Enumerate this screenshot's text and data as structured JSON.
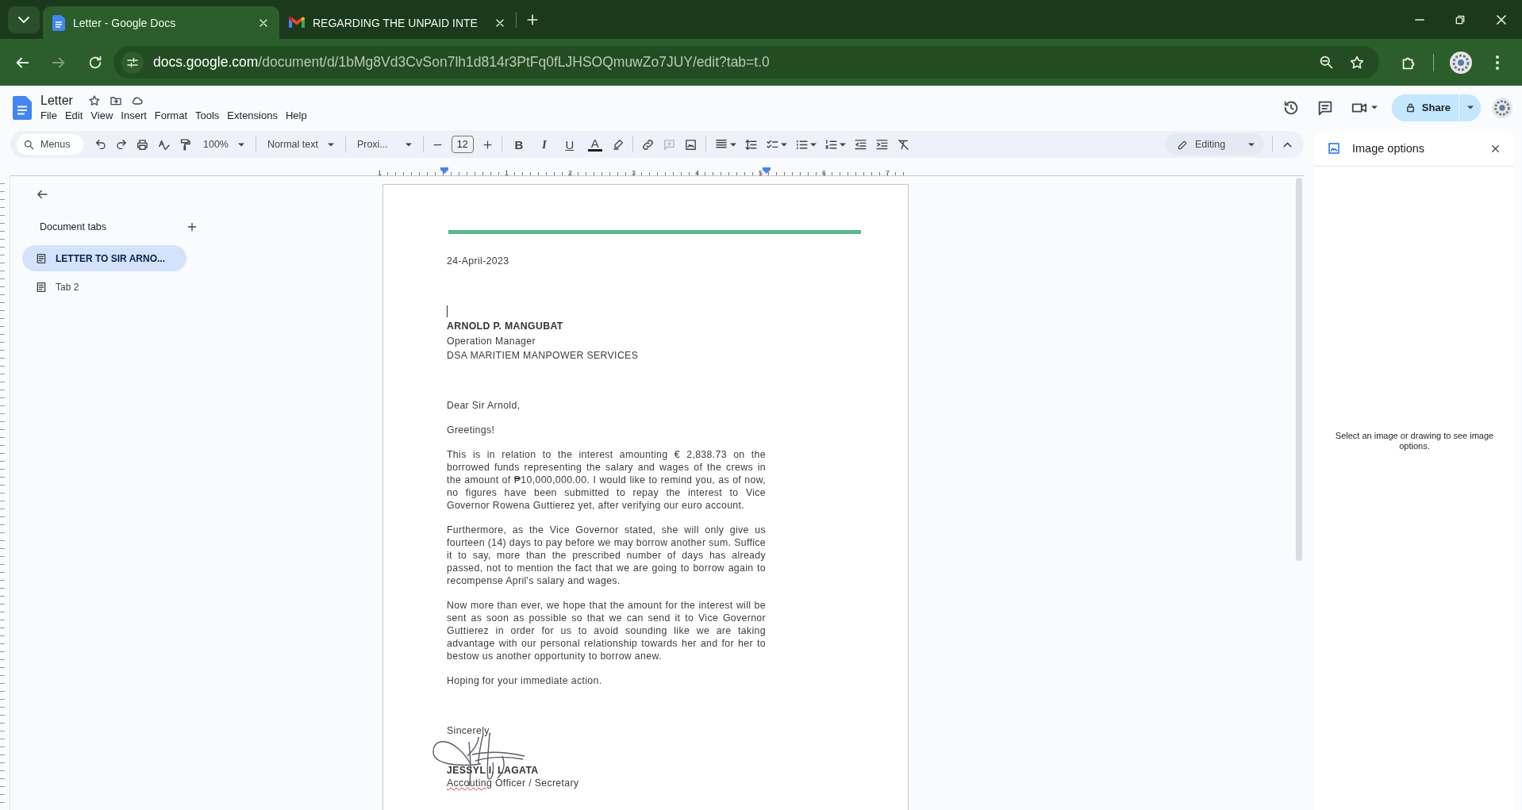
{
  "browser": {
    "tabs": [
      {
        "title": "Letter - Google Docs",
        "kind": "docs",
        "selected": true
      },
      {
        "title": "REGARDING THE UNPAID INTE",
        "kind": "mail",
        "selected": false
      }
    ],
    "nav_buttons": [
      {
        "kind": "back",
        "disabled": false
      },
      {
        "kind": "forward",
        "disabled": true
      },
      {
        "kind": "reload",
        "disabled": false
      }
    ],
    "address": {
      "host": "docs.google.com",
      "path": "/document/d/1bMg8Vd3CvSon7lh1d814r3PtFq0fLJHSOQmuwZo7JUY/edit?tab=t.0"
    }
  },
  "docs": {
    "title": "Letter",
    "menus": [
      "File",
      "Edit",
      "View",
      "Insert",
      "Format",
      "Tools",
      "Extensions",
      "Help"
    ],
    "share_label": "Share"
  },
  "toolbar": {
    "menu_search": {
      "placeholder": "Menus"
    },
    "zoom": "100%",
    "paragraph_style": "Normal text",
    "font": "Proxi...",
    "font_size": "12",
    "format_buttons": [
      {
        "label": "B",
        "kind": "bold"
      },
      {
        "label": "I",
        "kind": "italic"
      },
      {
        "label": "U",
        "kind": "underline"
      },
      {
        "label": "A",
        "kind": "text_color"
      }
    ],
    "mode": "Editing"
  },
  "ruler": {
    "labels": [
      "1",
      "1",
      "2",
      "3",
      "4",
      "5",
      "6",
      "7"
    ]
  },
  "sidebar": {
    "heading": "Document tabs",
    "tabs": [
      {
        "label": "LETTER TO SIR ARNO...",
        "selected": true
      },
      {
        "label": "Tab 2",
        "selected": false
      }
    ]
  },
  "document": {
    "date": "24-April-2023",
    "recipient": {
      "name": "ARNOLD P. MANGUBAT",
      "title": "Operation Manager",
      "company": "DSA MARITIEM MANPOWER SERVICES"
    },
    "salutation": "Dear Sir Arnold,",
    "greeting": "Greetings!",
    "paragraphs": [
      "This is in relation to the interest amounting € 2,838.73 on the borrowed funds representing the salary and wages of the crews in the amount of ₱10,000,000.00. I would like to remind you, as of now, no figures have been submitted to repay the interest to Vice Governor Rowena Guttierez yet, after verifying our euro account.",
      "Furthermore, as the Vice Governor stated, she will only give us fourteen (14) days to pay before we may borrow another sum. Suffice it to say, more than the prescribed number of days has already passed, not to mention the fact that we are going to borrow again to recompense April's salary and wages.",
      "Now more than ever, we hope that the amount for the interest will be sent as soon as possible so that we can send it to Vice Governor Guttierez in order for us to avoid sounding like we are taking advantage with our personal relationship towards her and for her to bestow us another opportunity to borrow anew."
    ],
    "request": "Hoping for your immediate action.",
    "closing": "Sincerely,",
    "signer": {
      "name": "JESSYL I. LAGATA",
      "title": [
        {
          "text": "Accouting",
          "misspelled": true
        },
        {
          "text": " Officer / Secretary",
          "misspelled": false
        }
      ]
    }
  },
  "image_options": {
    "title": "Image options",
    "hint": "Select an image or drawing to see image options."
  }
}
